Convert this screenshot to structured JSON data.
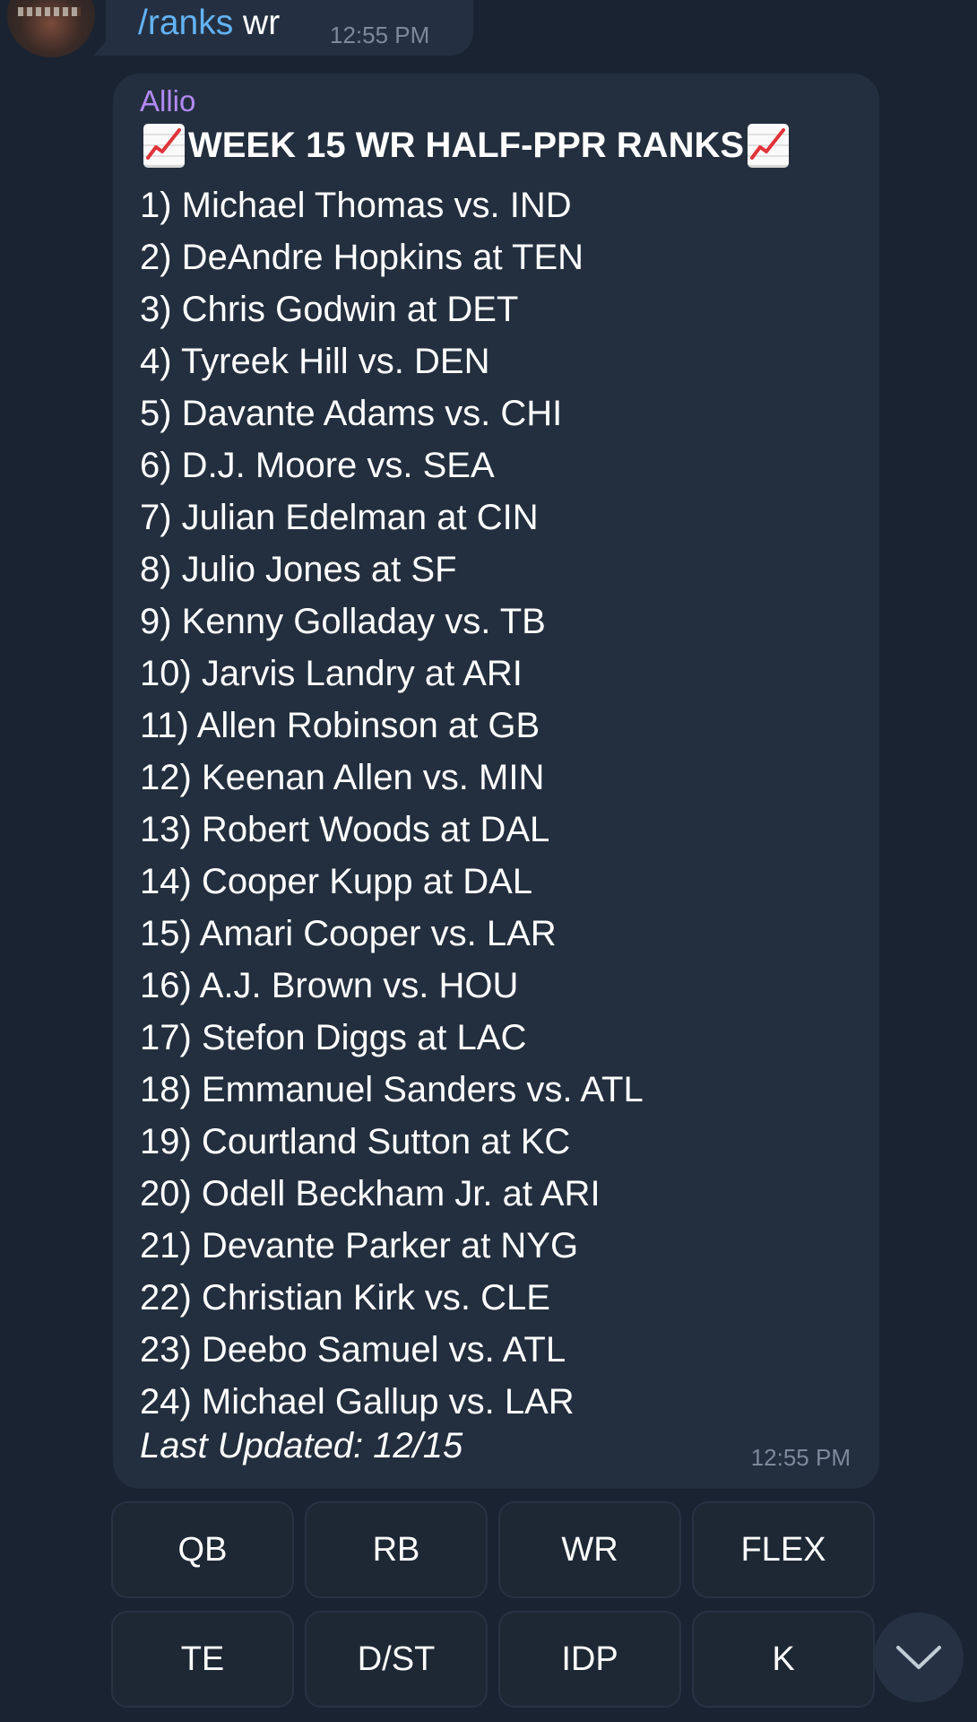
{
  "outgoing": {
    "command": "/ranks",
    "argument": "wr",
    "time": "12:55 PM"
  },
  "message": {
    "sender": "Allio",
    "title": "WEEK 15 WR HALF-PPR RANKS",
    "title_icon": "chart-increasing-icon",
    "ranks": [
      "1) Michael Thomas vs. IND",
      "2) DeAndre Hopkins at TEN",
      "3) Chris Godwin at DET",
      "4) Tyreek Hill vs. DEN",
      "5) Davante Adams vs. CHI",
      "6) D.J. Moore vs. SEA",
      "7) Julian Edelman at CIN",
      "8) Julio Jones at SF",
      "9) Kenny Golladay vs. TB",
      "10) Jarvis Landry at ARI",
      "11) Allen Robinson at GB",
      "12) Keenan Allen vs. MIN",
      "13) Robert Woods at DAL",
      "14) Cooper Kupp at DAL",
      "15) Amari Cooper vs. LAR",
      "16) A.J. Brown vs. HOU",
      "17) Stefon Diggs at LAC",
      "18) Emmanuel Sanders vs. ATL",
      "19) Courtland Sutton at KC",
      "20) Odell Beckham Jr. at ARI",
      "21) Devante Parker at NYG",
      "22) Christian Kirk vs. CLE",
      "23) Deebo Samuel vs. ATL",
      "24) Michael Gallup vs. LAR"
    ],
    "updated": "Last Updated: 12/15",
    "time": "12:55 PM"
  },
  "keyboard": {
    "row1": [
      "QB",
      "RB",
      "WR",
      "FLEX"
    ],
    "row2": [
      "TE",
      "D/ST",
      "IDP",
      "K"
    ]
  },
  "scroll_icon": "chevron-down-icon",
  "colors": {
    "background": "#1a2331",
    "bubble": "#232f3e",
    "link": "#63b3f5",
    "sender": "#b389f5",
    "timestamp": "#7c8a9b"
  }
}
